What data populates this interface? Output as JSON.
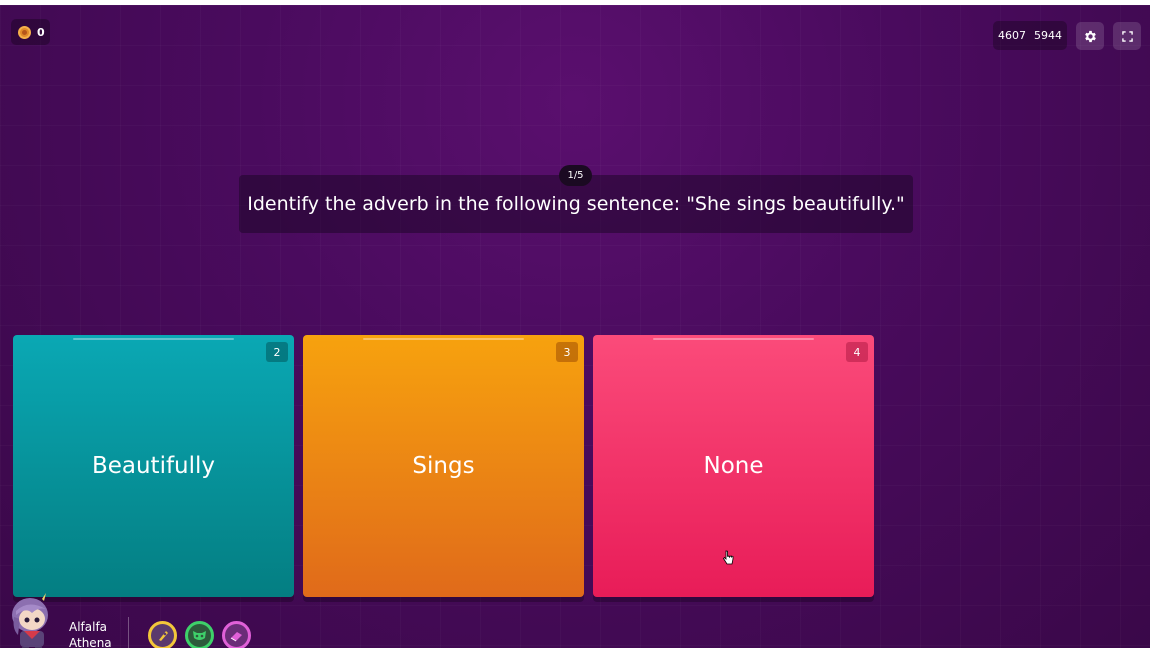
{
  "header": {
    "coins": {
      "icon": "coin-icon",
      "count": "0"
    },
    "score": {
      "left": "4607",
      "right": "5944"
    },
    "settings_icon": "gear-icon",
    "fullscreen_icon": "fullscreen-icon"
  },
  "question": {
    "counter": "1/5",
    "text": "Identify the adverb in the following sentence: \"She sings beautifully.\""
  },
  "options": [
    {
      "label": "Beautifully",
      "number": "2",
      "color": "#0a9aa4"
    },
    {
      "label": "Sings",
      "number": "3",
      "color": "#f0900f"
    },
    {
      "label": "None",
      "number": "4",
      "color": "#f53a6c"
    }
  ],
  "player": {
    "name_line1": "Alfalfa",
    "name_line2": "Athena"
  },
  "powerups": [
    {
      "icon": "rocket-powerup-icon",
      "ring_color": "#f3c63a"
    },
    {
      "icon": "mask-powerup-icon",
      "ring_color": "#3ed06a"
    },
    {
      "icon": "eraser-powerup-icon",
      "ring_color": "#e060d8"
    }
  ],
  "colors": {
    "background": "#4a0b5e"
  }
}
